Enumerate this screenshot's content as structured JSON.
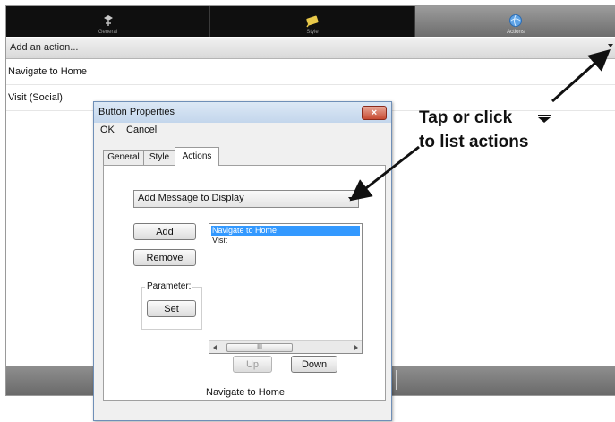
{
  "tabs": [
    {
      "label": "General",
      "icon": "general-icon"
    },
    {
      "label": "Style",
      "icon": "style-icon"
    },
    {
      "label": "Actions",
      "icon": "actions-icon"
    }
  ],
  "action_bar": {
    "label": "Add an action...",
    "icon": "dropdown-arrow-icon"
  },
  "actions_list": [
    "Navigate to Home",
    "Visit (Social)"
  ],
  "dialog": {
    "title": "Button Properties",
    "menu": {
      "ok": "OK",
      "cancel": "Cancel"
    },
    "tabs": [
      "General",
      "Style",
      "Actions"
    ],
    "active_tab": "Actions",
    "combo_value": "Add Message to Display",
    "buttons": {
      "add": "Add",
      "remove": "Remove",
      "set": "Set",
      "up": "Up",
      "down": "Down"
    },
    "parameter_label": "Parameter:",
    "list_items": [
      "Navigate to Home",
      "Visit"
    ],
    "selected_item": "Navigate to Home",
    "scroll_thumb_glyph": "III",
    "footer_value": "Navigate to Home"
  },
  "callout": {
    "line1": "Tap or click",
    "line2": "to list actions"
  },
  "colors": {
    "selection": "#3399ff",
    "close_button": "#c74b32",
    "tab_active": "#7d7d7d"
  }
}
